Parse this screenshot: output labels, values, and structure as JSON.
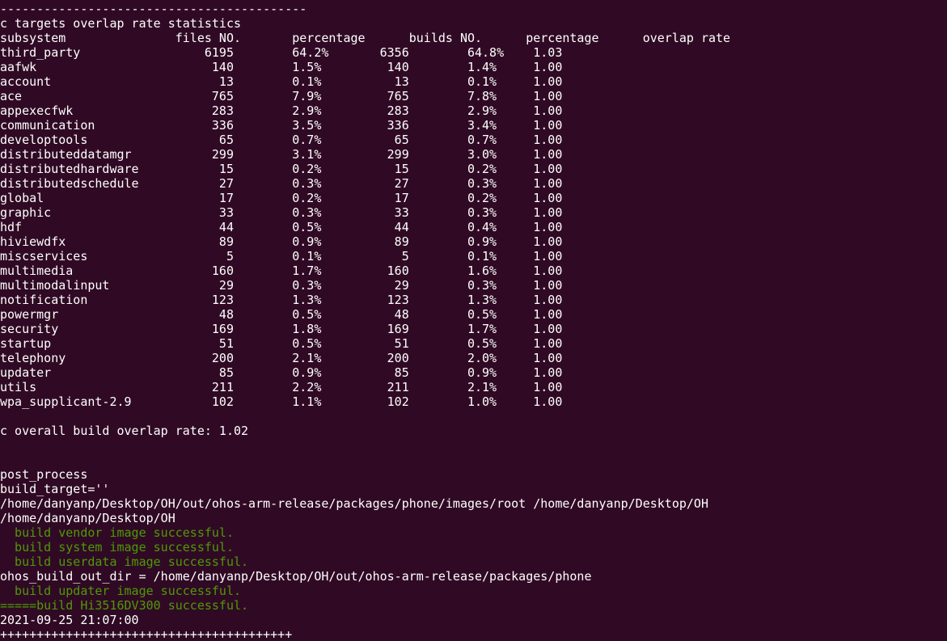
{
  "terminal": {
    "colors": {
      "background": "#300a24",
      "text": "#ffffff",
      "success": "#4e9a06"
    },
    "lines": [
      {
        "text": "------------------------------------------",
        "style": "normal"
      },
      {
        "text": "c targets overlap rate statistics",
        "style": "normal"
      },
      {
        "text": "subsystem               files NO.       percentage      builds NO.      percentage      overlap rate",
        "style": "normal"
      },
      {
        "text": "third_party                 6195        64.2%       6356        64.8%    1.03",
        "style": "normal"
      },
      {
        "text": "aafwk                        140        1.5%         140        1.4%     1.00",
        "style": "normal"
      },
      {
        "text": "account                       13        0.1%          13        0.1%     1.00",
        "style": "normal"
      },
      {
        "text": "ace                          765        7.9%         765        7.8%     1.00",
        "style": "normal"
      },
      {
        "text": "appexecfwk                   283        2.9%         283        2.9%     1.00",
        "style": "normal"
      },
      {
        "text": "communication                336        3.5%         336        3.4%     1.00",
        "style": "normal"
      },
      {
        "text": "developtools                  65        0.7%          65        0.7%     1.00",
        "style": "normal"
      },
      {
        "text": "distributeddatamgr           299        3.1%         299        3.0%     1.00",
        "style": "normal"
      },
      {
        "text": "distributedhardware           15        0.2%          15        0.2%     1.00",
        "style": "normal"
      },
      {
        "text": "distributedschedule           27        0.3%          27        0.3%     1.00",
        "style": "normal"
      },
      {
        "text": "global                        17        0.2%          17        0.2%     1.00",
        "style": "normal"
      },
      {
        "text": "graphic                       33        0.3%          33        0.3%     1.00",
        "style": "normal"
      },
      {
        "text": "hdf                           44        0.5%          44        0.4%     1.00",
        "style": "normal"
      },
      {
        "text": "hiviewdfx                     89        0.9%          89        0.9%     1.00",
        "style": "normal"
      },
      {
        "text": "miscservices                   5        0.1%           5        0.1%     1.00",
        "style": "normal"
      },
      {
        "text": "multimedia                   160        1.7%         160        1.6%     1.00",
        "style": "normal"
      },
      {
        "text": "multimodalinput               29        0.3%          29        0.3%     1.00",
        "style": "normal"
      },
      {
        "text": "notification                 123        1.3%         123        1.3%     1.00",
        "style": "normal"
      },
      {
        "text": "powermgr                      48        0.5%          48        0.5%     1.00",
        "style": "normal"
      },
      {
        "text": "security                     169        1.8%         169        1.7%     1.00",
        "style": "normal"
      },
      {
        "text": "startup                       51        0.5%          51        0.5%     1.00",
        "style": "normal"
      },
      {
        "text": "telephony                    200        2.1%         200        2.0%     1.00",
        "style": "normal"
      },
      {
        "text": "updater                       85        0.9%          85        0.9%     1.00",
        "style": "normal"
      },
      {
        "text": "utils                        211        2.2%         211        2.1%     1.00",
        "style": "normal"
      },
      {
        "text": "wpa_supplicant-2.9           102        1.1%         102        1.0%     1.00",
        "style": "normal"
      },
      {
        "text": "",
        "style": "normal"
      },
      {
        "text": "c overall build overlap rate: 1.02",
        "style": "normal"
      },
      {
        "text": "",
        "style": "normal"
      },
      {
        "text": "",
        "style": "normal"
      },
      {
        "text": "post_process",
        "style": "normal"
      },
      {
        "text": "build_target=''",
        "style": "normal"
      },
      {
        "text": "/home/danyanp/Desktop/OH/out/ohos-arm-release/packages/phone/images/root /home/danyanp/Desktop/OH",
        "style": "normal"
      },
      {
        "text": "/home/danyanp/Desktop/OH",
        "style": "normal"
      },
      {
        "text": "  build vendor image successful.",
        "style": "ok"
      },
      {
        "text": "  build system image successful.",
        "style": "ok"
      },
      {
        "text": "  build userdata image successful.",
        "style": "ok"
      },
      {
        "text": "ohos_build_out_dir = /home/danyanp/Desktop/OH/out/ohos-arm-release/packages/phone",
        "style": "normal"
      },
      {
        "text": "  build updater image successful.",
        "style": "ok"
      },
      {
        "text": "=====build Hi3516DV300 successful.",
        "style": "ok"
      },
      {
        "text": "2021-09-25 21:07:00",
        "style": "normal"
      },
      {
        "text": "++++++++++++++++++++++++++++++++++++++++",
        "style": "normal"
      }
    ]
  }
}
